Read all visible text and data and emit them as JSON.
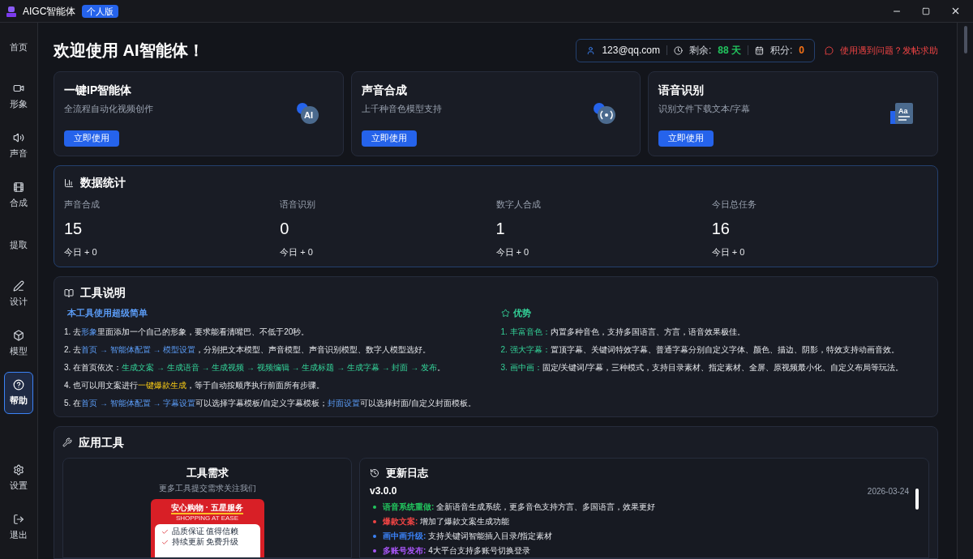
{
  "app": {
    "title": "AIGC智能体",
    "edition": "个人版"
  },
  "sidebar": {
    "items": [
      {
        "label": "首页",
        "kind": "text",
        "selected": false
      },
      {
        "label": "形象",
        "kind": "video",
        "selected": false
      },
      {
        "label": "声音",
        "kind": "volume",
        "selected": false
      },
      {
        "label": "合成",
        "kind": "film",
        "selected": false
      },
      {
        "label": "提取",
        "kind": "text",
        "selected": false
      },
      {
        "label": "设计",
        "kind": "pen",
        "selected": false
      },
      {
        "label": "模型",
        "kind": "box",
        "selected": false
      },
      {
        "label": "帮助",
        "kind": "help",
        "selected": true
      }
    ],
    "bottom": [
      {
        "label": "设置",
        "kind": "settings"
      },
      {
        "label": "退出",
        "kind": "logout"
      }
    ]
  },
  "header": {
    "title": "欢迎使用 AI智能体！",
    "account": "123@qq.com",
    "remaining_label": "剩余:",
    "remaining": "88 天",
    "points_label": "积分:",
    "points": "0",
    "help_link": "使用遇到问题？发帖求助"
  },
  "features": [
    {
      "title": "一键IP智能体",
      "subtitle": "全流程自动化视频创作",
      "button": "立即使用",
      "kind": "ai",
      "icon_text": "AI"
    },
    {
      "title": "声音合成",
      "subtitle": "上千种音色模型支持",
      "button": "立即使用",
      "kind": "voice"
    },
    {
      "title": "语音识别",
      "subtitle": "识别文件下载文本/字幕",
      "button": "立即使用",
      "kind": "text",
      "icon_text": "Aa"
    }
  ],
  "stats": {
    "title": "数据统计",
    "items": [
      {
        "label": "声音合成",
        "value": "15",
        "today": "今日 + 0"
      },
      {
        "label": "语音识别",
        "value": "0",
        "today": "今日 + 0"
      },
      {
        "label": "数字人合成",
        "value": "1",
        "today": "今日 + 0"
      },
      {
        "label": "今日总任务",
        "value": "16",
        "today": "今日 + 0"
      }
    ]
  },
  "guide": {
    "title": "工具说明",
    "left_heading": "本工具使用超级简单",
    "steps": [
      [
        {
          "text": "1. 去",
          "kind": "plain"
        },
        {
          "text": "形象",
          "kind": "link"
        },
        {
          "text": "里面添加一个自己的形象，要求能看清嘴巴、不低于20秒。",
          "kind": "plain"
        }
      ],
      [
        {
          "text": "2. 去",
          "kind": "plain"
        },
        {
          "text": "首页 → 智能体配置 → 模型设置",
          "kind": "link"
        },
        {
          "text": "，分别把文本模型、声音模型、声音识别模型、数字人模型选好。",
          "kind": "plain"
        }
      ],
      [
        {
          "text": "3. 在首页依次：",
          "kind": "plain"
        },
        {
          "text": "生成文案 → 生成语音 → 生成视频 → 视频编辑 → 生成标题 → 生成字幕 → 封面 → 发布",
          "kind": "step"
        },
        {
          "text": "。",
          "kind": "plain"
        }
      ],
      [
        {
          "text": "4. 也可以用文案进行",
          "kind": "plain"
        },
        {
          "text": "一键爆款生成",
          "kind": "highlight"
        },
        {
          "text": "，等于自动按顺序执行前面所有步骤。",
          "kind": "plain"
        }
      ],
      [
        {
          "text": "5. 在",
          "kind": "plain"
        },
        {
          "text": "首页 → 智能体配置 → 字幕设置",
          "kind": "link"
        },
        {
          "text": "可以选择字幕模板/自定义字幕模板；",
          "kind": "plain"
        },
        {
          "text": "封面设置",
          "kind": "link"
        },
        {
          "text": "可以选择封面/自定义封面模板。",
          "kind": "plain"
        }
      ]
    ],
    "right_heading": "优势",
    "advantages": [
      {
        "label": "1. 丰富音色：",
        "text": "内置多种音色，支持多国语言、方言，语音效果极佳。"
      },
      {
        "label": "2. 强大字幕：",
        "text": "置顶字幕、关键词特效字幕、普通字幕分别自定义字体、颜色、描边、阴影，特效支持动画音效。"
      },
      {
        "label": "3. 画中画：",
        "text": "固定/关键词/字幕，三种模式，支持目录素材、指定素材、全屏、原视频最小化、自定义布局等玩法。"
      }
    ]
  },
  "tools": {
    "title": "应用工具",
    "request": {
      "title": "工具需求",
      "subtitle": "更多工具提交需求关注我们",
      "promo": {
        "headline": "安心购物 · 五星服务",
        "tagline": "SHOPPING AT EASE",
        "points": [
          "品质保证 值得信赖",
          "持续更新 免费升级"
        ]
      }
    },
    "changelog": {
      "title": "更新日志",
      "version": "v3.0.0",
      "date": "2026-03-24",
      "items": [
        {
          "label": "语音系统重做:",
          "text": "全新语音生成系统，更多音色支持方言、多国语言，效果更好",
          "color": "#22c55e"
        },
        {
          "label": "爆款文案:",
          "text": "增加了爆款文案生成功能",
          "color": "#ef4444"
        },
        {
          "label": "画中画升级:",
          "text": "支持关键词智能插入目录/指定素材",
          "color": "#3b82f6"
        },
        {
          "label": "多账号发布:",
          "text": "4大平台支持多账号切换登录",
          "color": "#a855f7"
        }
      ]
    }
  }
}
